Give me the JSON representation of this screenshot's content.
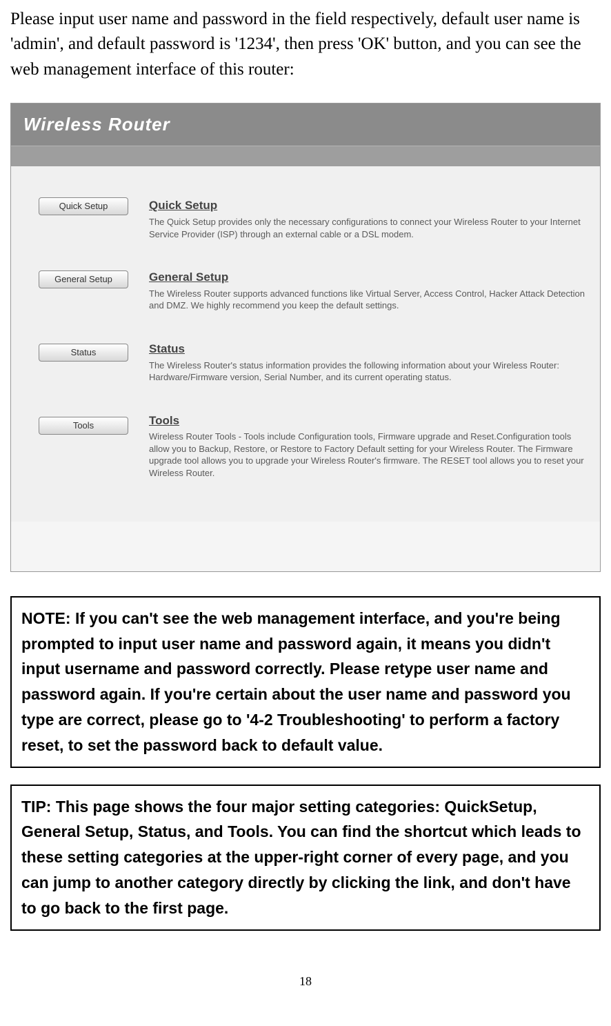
{
  "intro": "Please input user name and password in the field respectively, default user name is 'admin', and default password is '1234', then press 'OK' button, and you can see the web management interface of this router:",
  "router": {
    "header": "Wireless Router",
    "sections": [
      {
        "button": "Quick Setup",
        "title": "Quick Setup",
        "desc": "The Quick Setup provides only the necessary configurations to connect your Wireless Router to your Internet Service Provider (ISP) through an external cable or a DSL modem."
      },
      {
        "button": "General Setup",
        "title": "General Setup",
        "desc": "The Wireless Router supports advanced functions like Virtual Server, Access Control, Hacker Attack Detection and DMZ. We highly recommend you keep the default settings."
      },
      {
        "button": "Status",
        "title": "Status",
        "desc": "The Wireless Router's status information provides the following information about your Wireless Router: Hardware/Firmware version, Serial Number, and its current operating status."
      },
      {
        "button": "Tools",
        "title": "Tools",
        "desc": "Wireless Router Tools - Tools include Configuration tools, Firmware upgrade and Reset.Configuration tools allow you to Backup, Restore, or Restore to Factory Default setting for your Wireless Router. The Firmware upgrade tool allows you to upgrade your Wireless Router's firmware. The RESET tool allows you to reset your Wireless Router."
      }
    ]
  },
  "note": "NOTE: If you can't see the web management interface, and you're being prompted to input user name and password again, it means you didn't input username and password correctly. Please retype user name and password again. If you're certain about the user name and password you type are correct, please go to '4-2 Troubleshooting' to perform a factory reset, to set the password back to default value.",
  "tip": "TIP: This page shows the four major setting categories: QuickSetup, General Setup, Status, and Tools. You can find the shortcut which leads to these setting categories at the upper-right corner of every page, and you can jump to another category directly by clicking the link, and don't have to go back to the first page.",
  "page_number": "18"
}
